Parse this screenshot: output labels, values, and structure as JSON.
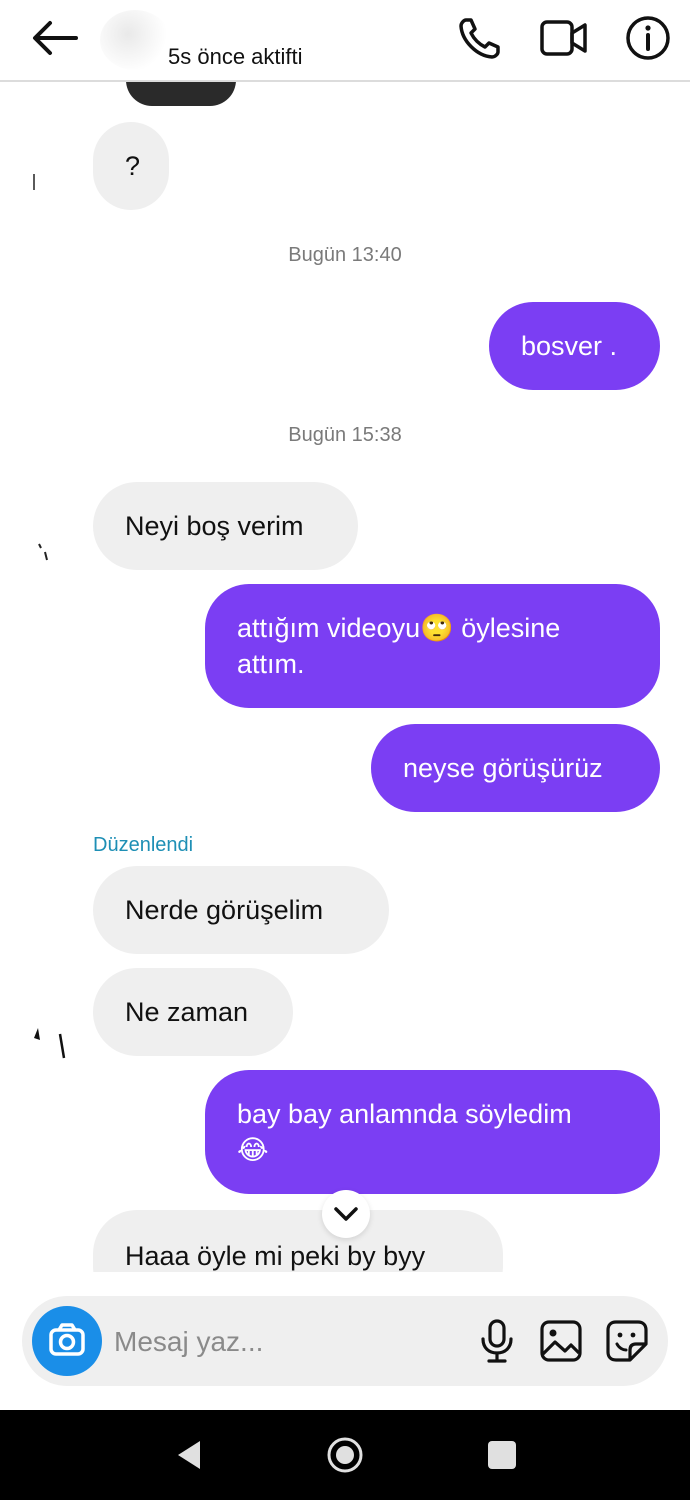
{
  "header": {
    "status": "5s önce aktifti"
  },
  "icons": {
    "back": "arrow-left-icon",
    "call": "phone-icon",
    "video": "video-camera-icon",
    "info": "info-icon",
    "scroll": "chevron-down-icon",
    "camera": "camera-icon",
    "mic": "microphone-icon",
    "gallery": "image-icon",
    "sticker": "sticker-icon"
  },
  "messages": [
    {
      "side": "incoming",
      "text": "?"
    },
    {
      "side": "timestamp",
      "text": "Bugün 13:40"
    },
    {
      "side": "outgoing",
      "text": "bosver ."
    },
    {
      "side": "timestamp",
      "text": "Bugün 15:38"
    },
    {
      "side": "incoming",
      "text": "Neyi boş verim"
    },
    {
      "side": "outgoing",
      "text": "attığım videoyu🙄 öylesine\nattım."
    },
    {
      "side": "outgoing",
      "text": "neyse görüşürüz"
    },
    {
      "side": "edited",
      "text": "Düzenlendi"
    },
    {
      "side": "incoming",
      "text": "Nerde görüşelim"
    },
    {
      "side": "incoming",
      "text": "Ne zaman"
    },
    {
      "side": "outgoing",
      "text": "bay bay anlamnda söyledim\n😂"
    },
    {
      "side": "incoming",
      "text": "Haaa öyle mi peki by byy"
    }
  ],
  "composer": {
    "placeholder": "Mesaj yaz..."
  },
  "colors": {
    "outgoing_bubble": "#7b3ef3",
    "incoming_bubble": "#efefef",
    "camera_button": "#1a8ee8",
    "edited_label": "#1e8fb5"
  }
}
